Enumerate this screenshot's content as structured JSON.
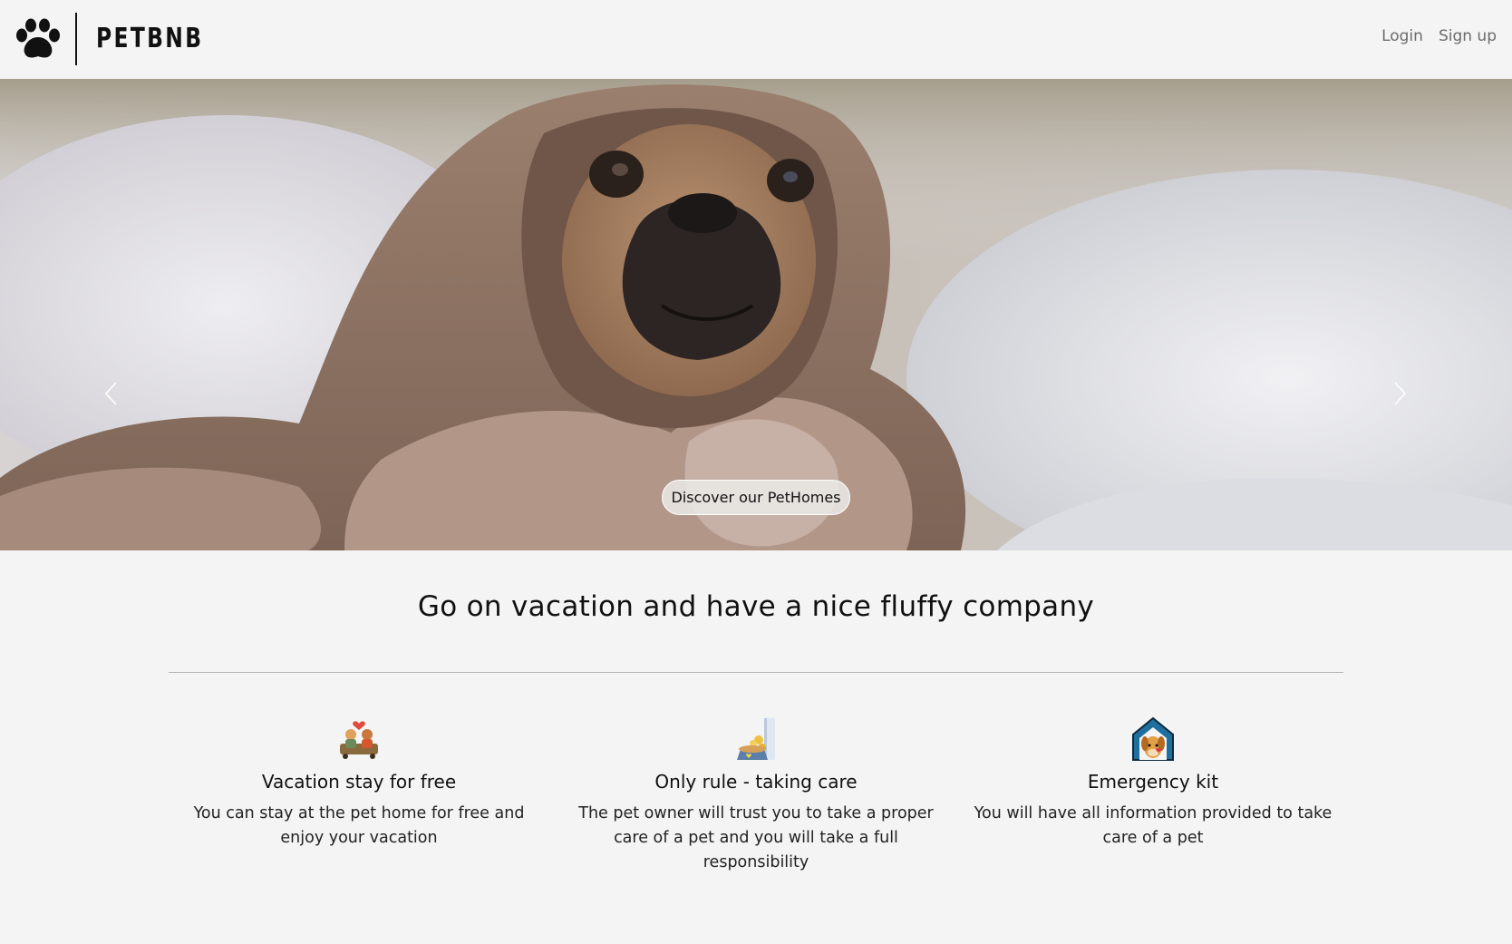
{
  "header": {
    "logo_text": "PETBNB",
    "logo_icon": "paw-icon",
    "nav": {
      "login_label": "Login",
      "signup_label": "Sign up"
    }
  },
  "hero": {
    "image": "pug-in-blanket-photo",
    "prev_icon": "chevron-left-icon",
    "next_icon": "chevron-right-icon",
    "cta_label": "Discover our PetHomes"
  },
  "main": {
    "headline": "Go on vacation and have a nice fluffy company",
    "features": [
      {
        "icon": "vacation-people-icon",
        "title": "Vacation stay for free",
        "text": "You can stay at the pet home for free and enjoy your vacation"
      },
      {
        "icon": "pet-food-icon",
        "title": "Only rule - taking care",
        "text": "The pet owner will trust you to take a proper care of a pet and you will take a full responsibility"
      },
      {
        "icon": "pet-house-icon",
        "title": "Emergency kit",
        "text": "You will have all information provided to take care of a pet"
      }
    ]
  },
  "colors": {
    "background": "#f4f4f4",
    "text": "#111111",
    "nav_link": "#6b6b6b",
    "divider": "#b5b5b5"
  }
}
